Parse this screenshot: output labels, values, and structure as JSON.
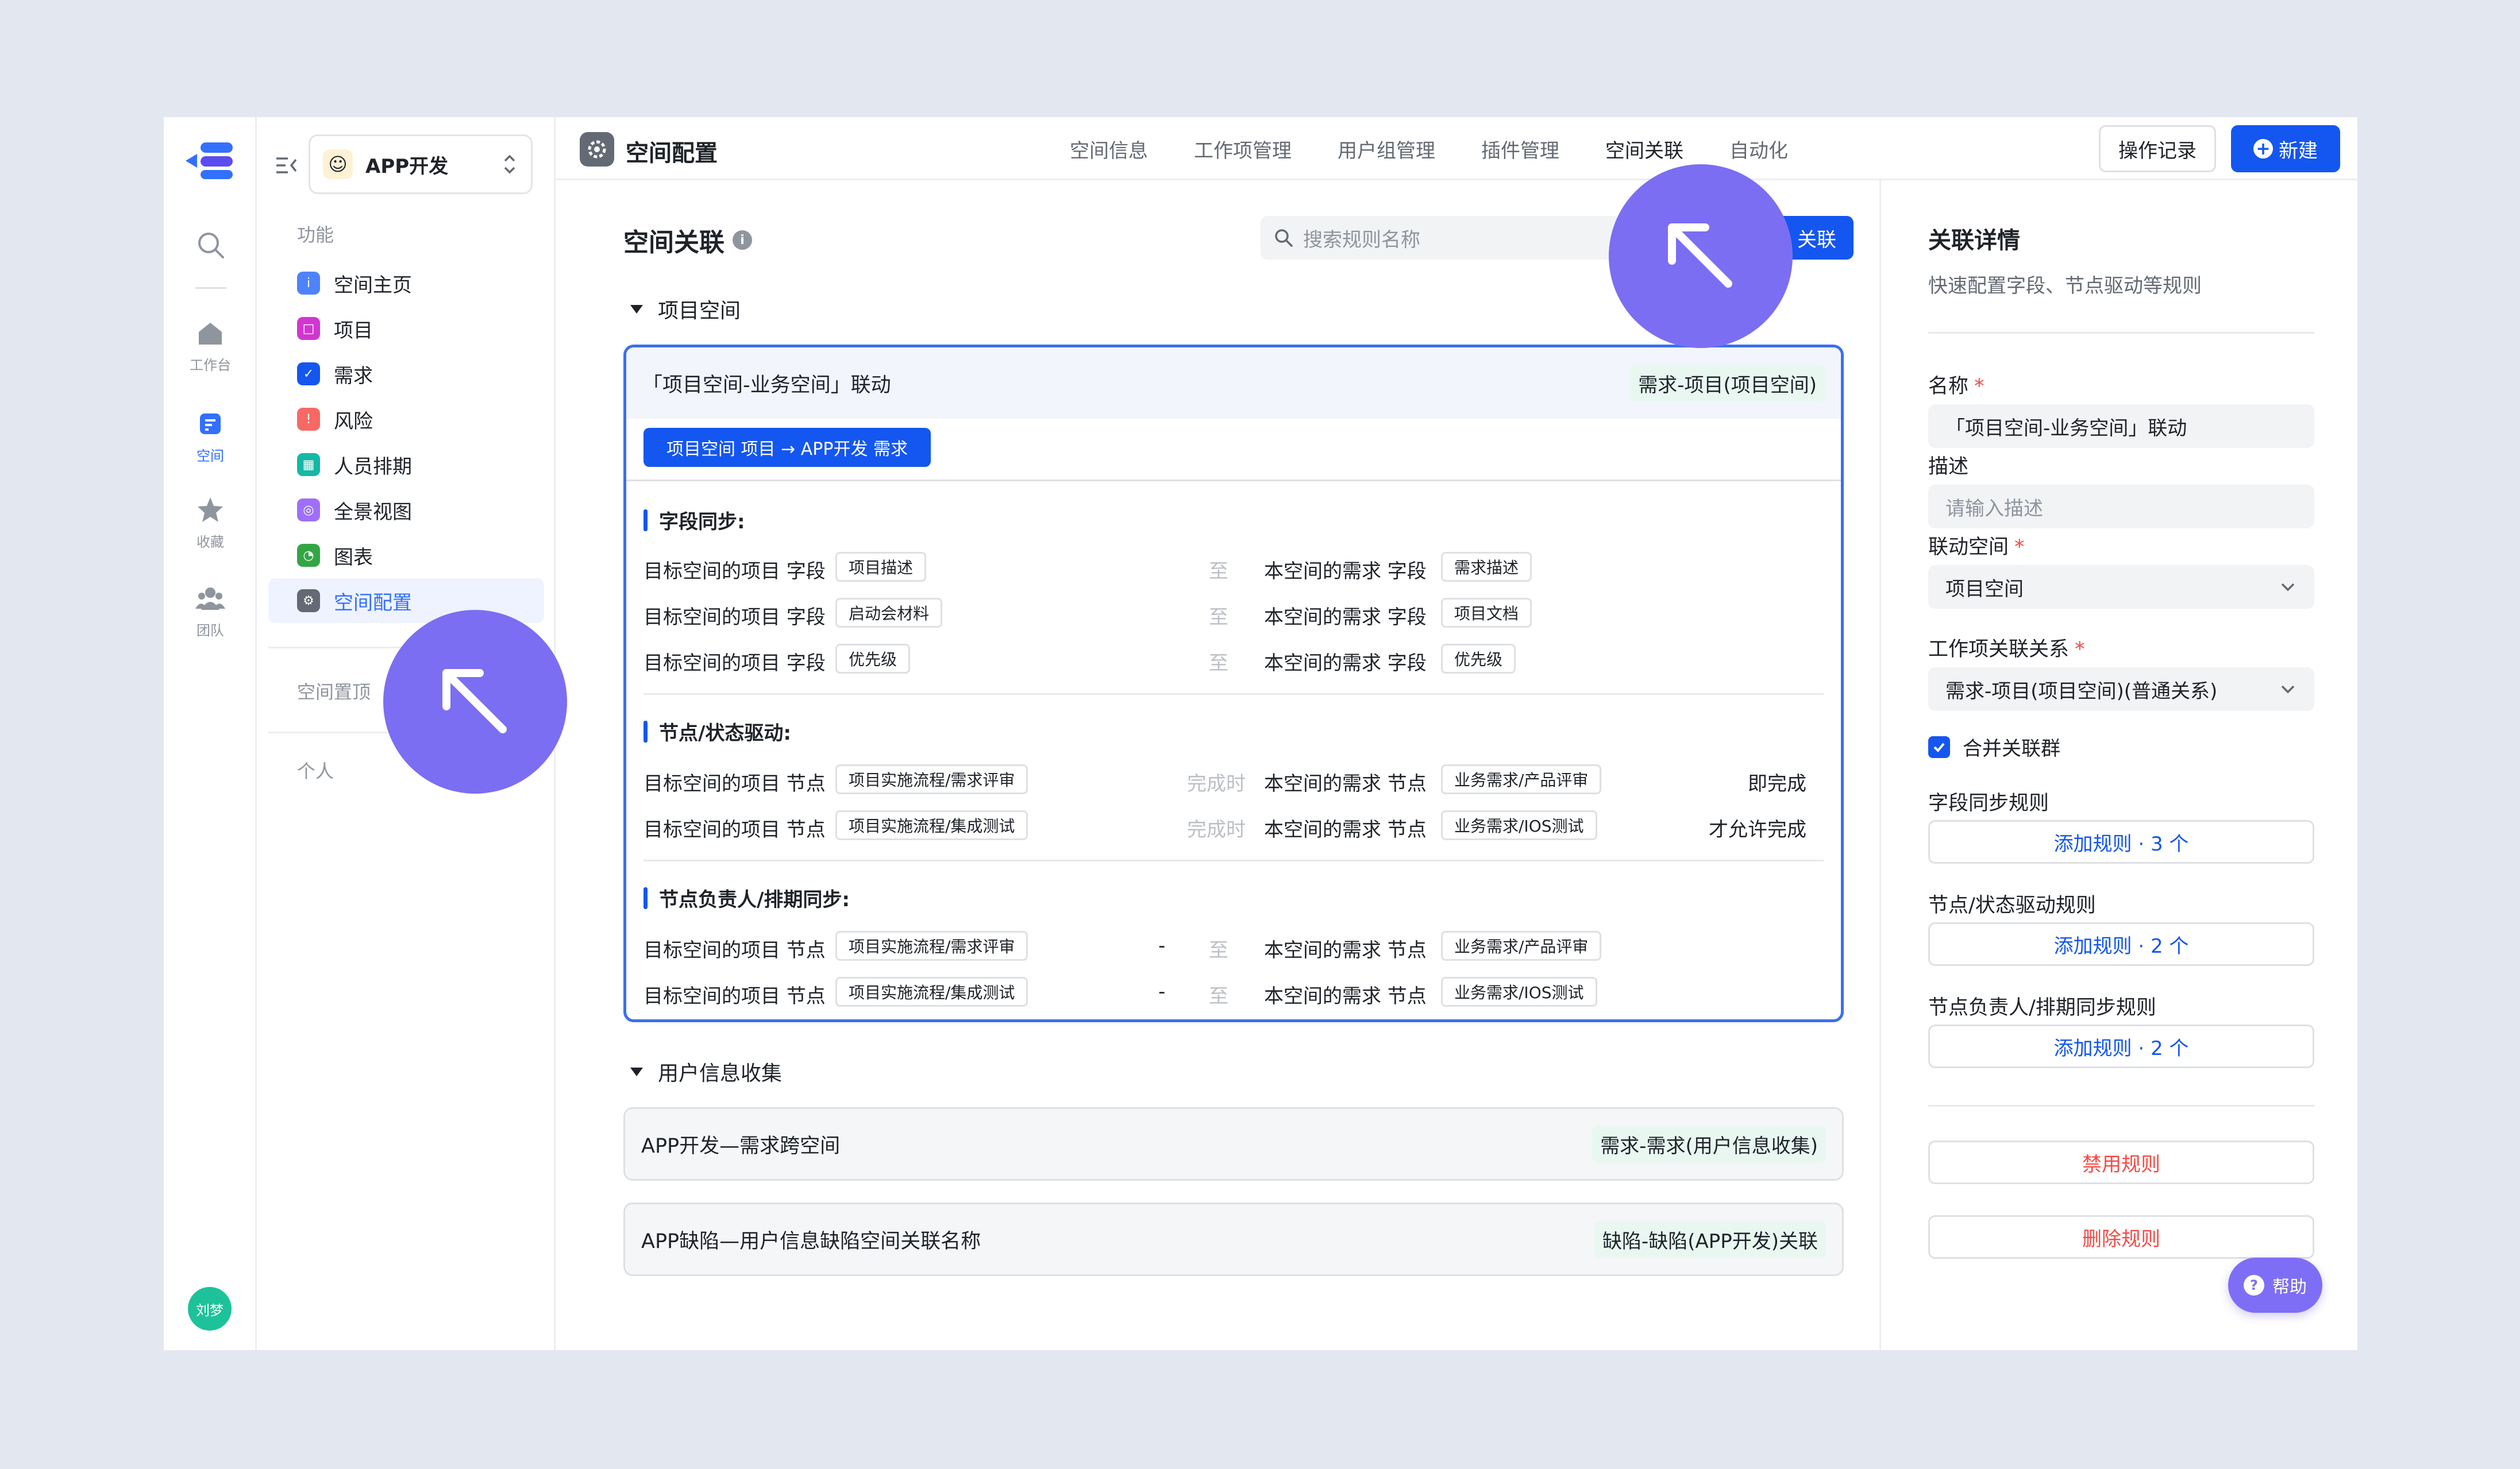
{
  "rail": {
    "items": [
      {
        "label": "工作台"
      },
      {
        "label": "空间"
      },
      {
        "label": "收藏"
      },
      {
        "label": "团队"
      }
    ],
    "avatar_text": "刘梦"
  },
  "sidebar": {
    "space_name": "APP开发",
    "section_features": "功能",
    "items": [
      {
        "label": "空间主页",
        "color": "#4e83fd"
      },
      {
        "label": "项目",
        "color": "#d136d1"
      },
      {
        "label": "需求",
        "color": "#1456f0"
      },
      {
        "label": "风险",
        "color": "#f76964"
      },
      {
        "label": "人员排期",
        "color": "#14b8a6"
      },
      {
        "label": "全景视图",
        "color": "#9f6ffa"
      },
      {
        "label": "图表",
        "color": "#32a645"
      },
      {
        "label": "空间配置",
        "color": "#646a73"
      }
    ],
    "section_pinned": "空间置顶",
    "section_personal": "个人"
  },
  "topbar": {
    "title": "空间配置",
    "tabs": [
      "空间信息",
      "工作项管理",
      "用户组管理",
      "插件管理",
      "空间关联",
      "自动化"
    ],
    "active_tab": "空间关联",
    "record_button": "操作记录",
    "new_button": "新建"
  },
  "main": {
    "title": "空间关联",
    "search_placeholder": "搜索规则名称",
    "add_button": "添加关联",
    "add_button_visible": "关联",
    "group1": {
      "title": "项目空间",
      "card": {
        "name": "「项目空间-业务空间」联动",
        "relation": "需求-项目(项目空间)",
        "path": "项目空间  项目 → APP开发  需求",
        "sections": {
          "field_sync": {
            "title": "字段同步:",
            "rows": [
              {
                "left": "目标空间的项目 字段",
                "left_tag": "项目描述",
                "mid": "至",
                "right": "本空间的需求 字段",
                "right_tag": "需求描述"
              },
              {
                "left": "目标空间的项目 字段",
                "left_tag": "启动会材料",
                "mid": "至",
                "right": "本空间的需求 字段",
                "right_tag": "项目文档"
              },
              {
                "left": "目标空间的项目 字段",
                "left_tag": "优先级",
                "mid": "至",
                "right": "本空间的需求 字段",
                "right_tag": "优先级"
              }
            ]
          },
          "node_drive": {
            "title": "节点/状态驱动:",
            "rows": [
              {
                "left": "目标空间的项目 节点",
                "left_tag": "项目实施流程/需求评审",
                "mid": "完成时",
                "right": "本空间的需求 节点",
                "right_tag": "业务需求/产品评审",
                "end": "即完成"
              },
              {
                "left": "目标空间的项目 节点",
                "left_tag": "项目实施流程/集成测试",
                "mid": "完成时",
                "right": "本空间的需求 节点",
                "right_tag": "业务需求/IOS测试",
                "end": "才允许完成"
              }
            ]
          },
          "owner_sync": {
            "title": "节点负责人/排期同步:",
            "rows": [
              {
                "left": "目标空间的项目 节点",
                "left_tag": "项目实施流程/需求评审",
                "dash": "-",
                "mid": "至",
                "right": "本空间的需求 节点",
                "right_tag": "业务需求/产品评审"
              },
              {
                "left": "目标空间的项目 节点",
                "left_tag": "项目实施流程/集成测试",
                "dash": "-",
                "mid": "至",
                "right": "本空间的需求 节点",
                "right_tag": "业务需求/IOS测试"
              }
            ]
          }
        }
      }
    },
    "group2": {
      "title": "用户信息收集",
      "cards": [
        {
          "name": "APP开发—需求跨空间",
          "relation": "需求-需求(用户信息收集)"
        },
        {
          "name": "APP缺陷—用户信息缺陷空间关联名称",
          "relation": "缺陷-缺陷(APP开发)关联"
        }
      ]
    }
  },
  "detail": {
    "title": "关联详情",
    "subtitle": "快速配置字段、节点驱动等规则",
    "name_label": "名称",
    "name_value": "「项目空间-业务空间」联动",
    "desc_label": "描述",
    "desc_placeholder": "请输入描述",
    "space_label": "联动空间",
    "space_value": "项目空间",
    "relation_label": "工作项关联关系",
    "relation_value": "需求-项目(项目空间)(普通关系)",
    "merge_label": "合并关联群",
    "merge_checked": true,
    "field_rule_label": "字段同步规则",
    "field_rule_btn": "添加规则 · 3 个",
    "node_rule_label": "节点/状态驱动规则",
    "node_rule_btn": "添加规则 · 2 个",
    "owner_rule_label": "节点负责人/排期同步规则",
    "owner_rule_btn": "添加规则 · 2 个",
    "disable_btn": "禁用规则",
    "delete_btn": "删除规则"
  },
  "help": {
    "label": "帮助"
  },
  "colors": {
    "accent": "#1456f0",
    "cursor": "#7b6ef2",
    "danger": "#f54a45"
  }
}
